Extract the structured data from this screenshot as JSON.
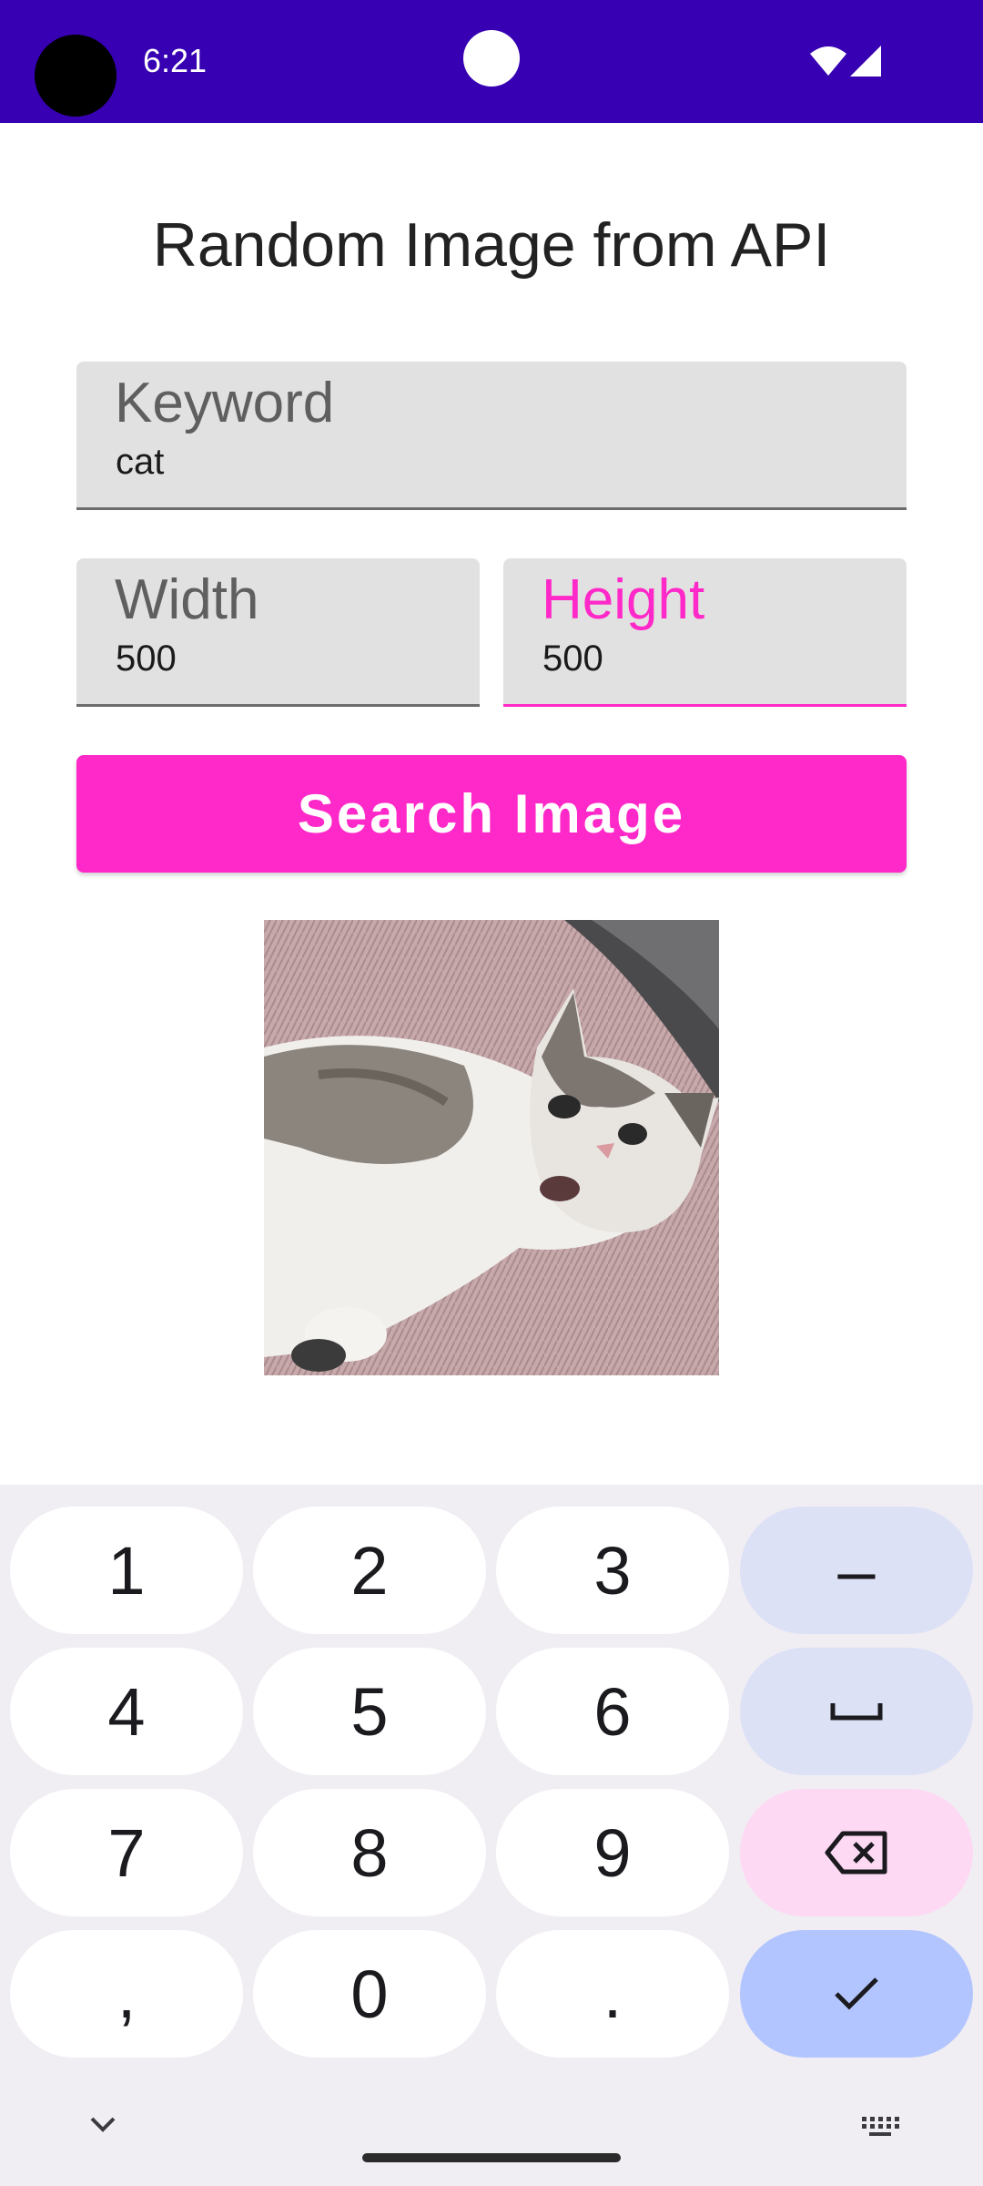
{
  "status_bar": {
    "time": "6:21",
    "icons": [
      "wifi-icon",
      "cellular-signal-icon"
    ]
  },
  "app": {
    "title": "Random Image from API",
    "accent_color": "#ff28c8",
    "status_bar_color": "#3700b3"
  },
  "form": {
    "keyword": {
      "label": "Keyword",
      "value": "cat"
    },
    "width": {
      "label": "Width",
      "value": "500"
    },
    "height": {
      "label": "Height",
      "value": "500",
      "focused": true
    },
    "search_button": "Search Image"
  },
  "result_image": {
    "subject": "cat lying on pink fluffy bed"
  },
  "keyboard": {
    "type": "numeric",
    "rows": [
      [
        "1",
        "2",
        "3",
        "–"
      ],
      [
        "4",
        "5",
        "6",
        "space-icon"
      ],
      [
        "7",
        "8",
        "9",
        "backspace-icon"
      ],
      [
        ",",
        "0",
        ".",
        "checkmark-icon"
      ]
    ],
    "keys": {
      "k1": "1",
      "k2": "2",
      "k3": "3",
      "dash": "–",
      "k4": "4",
      "k5": "5",
      "k6": "6",
      "k7": "7",
      "k8": "8",
      "k9": "9",
      "comma": ",",
      "k0": "0",
      "period": "."
    }
  }
}
